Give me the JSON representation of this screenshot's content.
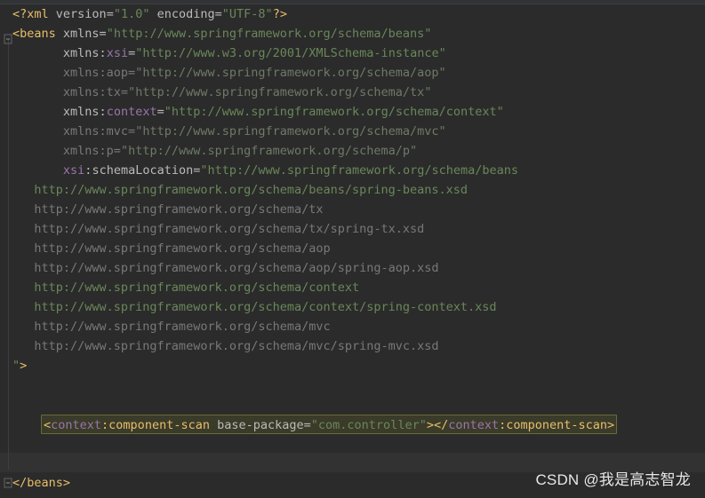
{
  "editor": {
    "language": "xml",
    "lines": [
      {
        "segments": [
          {
            "t": "<?xml ",
            "c": "t-tag"
          },
          {
            "t": "version",
            "c": "t-attr"
          },
          {
            "t": "=",
            "c": "t-attr"
          },
          {
            "t": "\"1.0\"",
            "c": "t-str"
          },
          {
            "t": " ",
            "c": "t-attr"
          },
          {
            "t": "encoding",
            "c": "t-attr"
          },
          {
            "t": "=",
            "c": "t-attr"
          },
          {
            "t": "\"UTF-8\"",
            "c": "t-str"
          },
          {
            "t": "?>",
            "c": "t-tag"
          }
        ]
      },
      {
        "segments": [
          {
            "t": "<beans ",
            "c": "t-tag"
          },
          {
            "t": "xmlns",
            "c": "t-attr"
          },
          {
            "t": "=",
            "c": "t-attr"
          },
          {
            "t": "\"http://www.springframework.org/schema/beans\"",
            "c": "t-str"
          }
        ]
      },
      {
        "segments": [
          {
            "t": "       ",
            "c": "t-attr"
          },
          {
            "t": "xmlns",
            "c": "t-attr"
          },
          {
            "t": ":",
            "c": "t-attr"
          },
          {
            "t": "xsi",
            "c": "t-ns"
          },
          {
            "t": "=",
            "c": "t-attr"
          },
          {
            "t": "\"http://www.w3.org/2001/XMLSchema-instance\"",
            "c": "t-str"
          }
        ]
      },
      {
        "segments": [
          {
            "t": "       ",
            "c": "t-dim"
          },
          {
            "t": "xmlns:aop=",
            "c": "t-dim"
          },
          {
            "t": "\"http://www.springframework.org/schema/aop\"",
            "c": "t-dimstr"
          }
        ]
      },
      {
        "segments": [
          {
            "t": "       ",
            "c": "t-dim"
          },
          {
            "t": "xmlns:tx=",
            "c": "t-dim"
          },
          {
            "t": "\"http://www.springframework.org/schema/tx\"",
            "c": "t-dimstr"
          }
        ]
      },
      {
        "segments": [
          {
            "t": "       ",
            "c": "t-attr"
          },
          {
            "t": "xmlns",
            "c": "t-attr"
          },
          {
            "t": ":",
            "c": "t-attr"
          },
          {
            "t": "context",
            "c": "t-ns"
          },
          {
            "t": "=",
            "c": "t-attr"
          },
          {
            "t": "\"http://www.springframework.org/schema/context\"",
            "c": "t-str"
          }
        ]
      },
      {
        "segments": [
          {
            "t": "       ",
            "c": "t-dim"
          },
          {
            "t": "xmlns:mvc=",
            "c": "t-dim"
          },
          {
            "t": "\"http://www.springframework.org/schema/mvc\"",
            "c": "t-dimstr"
          }
        ]
      },
      {
        "segments": [
          {
            "t": "       ",
            "c": "t-dim"
          },
          {
            "t": "xmlns:p=",
            "c": "t-dim"
          },
          {
            "t": "\"http://www.springframework.org/schema/p\"",
            "c": "t-dimstr"
          }
        ]
      },
      {
        "segments": [
          {
            "t": "       ",
            "c": "t-attr"
          },
          {
            "t": "xsi",
            "c": "t-ns"
          },
          {
            "t": ":",
            "c": "t-attr"
          },
          {
            "t": "schemaLocation",
            "c": "t-attr"
          },
          {
            "t": "=",
            "c": "t-attr"
          },
          {
            "t": "\"http://www.springframework.org/schema/beans",
            "c": "t-str"
          }
        ]
      },
      {
        "segments": [
          {
            "t": "   http://www.springframework.org/schema/beans/spring-beans.xsd",
            "c": "t-url-a"
          }
        ]
      },
      {
        "segments": [
          {
            "t": "   http://www.springframework.org/schema/tx",
            "c": "t-url-b"
          }
        ]
      },
      {
        "segments": [
          {
            "t": "   http://www.springframework.org/schema/tx/spring-tx.xsd",
            "c": "t-url-b"
          }
        ]
      },
      {
        "segments": [
          {
            "t": "   http://www.springframework.org/schema/aop",
            "c": "t-url-b"
          }
        ]
      },
      {
        "segments": [
          {
            "t": "   http://www.springframework.org/schema/aop/spring-aop.xsd",
            "c": "t-url-b"
          }
        ]
      },
      {
        "segments": [
          {
            "t": "   http://www.springframework.org/schema/context",
            "c": "t-url-a"
          }
        ]
      },
      {
        "segments": [
          {
            "t": "   http://www.springframework.org/schema/context/spring-context.xsd",
            "c": "t-url-a"
          }
        ]
      },
      {
        "segments": [
          {
            "t": "   http://www.springframework.org/schema/mvc",
            "c": "t-url-b"
          }
        ]
      },
      {
        "segments": [
          {
            "t": "   http://www.springframework.org/schema/mvc/spring-mvc.xsd",
            "c": "t-url-b"
          }
        ]
      },
      {
        "segments": [
          {
            "t": "\"",
            "c": "t-str"
          },
          {
            "t": ">",
            "c": "t-tag"
          }
        ]
      },
      {
        "segments": []
      },
      {
        "segments": []
      },
      {
        "segments": [
          {
            "t": "<",
            "c": "t-tag"
          },
          {
            "t": "context",
            "c": "t-ns"
          },
          {
            "t": ":component-scan ",
            "c": "t-tag"
          },
          {
            "t": "base-package",
            "c": "t-attr"
          },
          {
            "t": "=",
            "c": "t-attr"
          },
          {
            "t": "\"com.controller\"",
            "c": "t-str"
          },
          {
            "t": "></",
            "c": "t-tag"
          },
          {
            "t": "context",
            "c": "t-ns"
          },
          {
            "t": ":component-scan>",
            "c": "t-tag"
          }
        ],
        "highlight": true
      },
      {
        "segments": []
      },
      {
        "segments": [],
        "current": true
      },
      {
        "segments": [
          {
            "t": "</beans>",
            "c": "t-tag"
          }
        ]
      }
    ]
  },
  "watermark": {
    "text": "CSDN @我是高志智龙"
  },
  "icons": {
    "fold_open": "fold-open-icon",
    "fold_close": "fold-close-icon"
  }
}
